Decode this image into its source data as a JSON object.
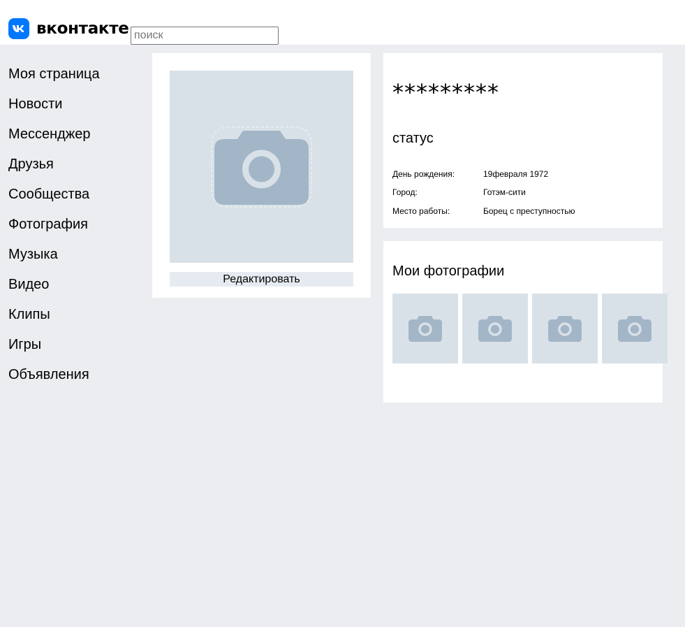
{
  "header": {
    "logo_text": "вконтакте",
    "search_placeholder": "поиск"
  },
  "colors": {
    "brand": "#0077ff",
    "page_bg": "#ebedf0",
    "placeholder_bg": "#d9e1e8",
    "camera_icon": "#a3b6c7"
  },
  "sidebar": {
    "items": [
      {
        "label": "Моя страница"
      },
      {
        "label": "Новости"
      },
      {
        "label": "Мессенджер"
      },
      {
        "label": "Друзья"
      },
      {
        "label": "Сообщества"
      },
      {
        "label": "Фотография"
      },
      {
        "label": "Музыка"
      },
      {
        "label": "Видео"
      },
      {
        "label": "Клипы"
      },
      {
        "label": "Игры"
      },
      {
        "label": "Объявления"
      }
    ]
  },
  "profile": {
    "avatar_icon": "camera-icon",
    "edit_label": "Редактировать",
    "name": "*********",
    "status": "статус",
    "info": [
      {
        "label": "День рождения:",
        "value": "19февраля 1972"
      },
      {
        "label": "Город:",
        "value": "Готэм-сити"
      },
      {
        "label": "Место работы:",
        "value": "Борец с преступностью"
      }
    ]
  },
  "photos": {
    "title": "Мои фотографии"
  }
}
